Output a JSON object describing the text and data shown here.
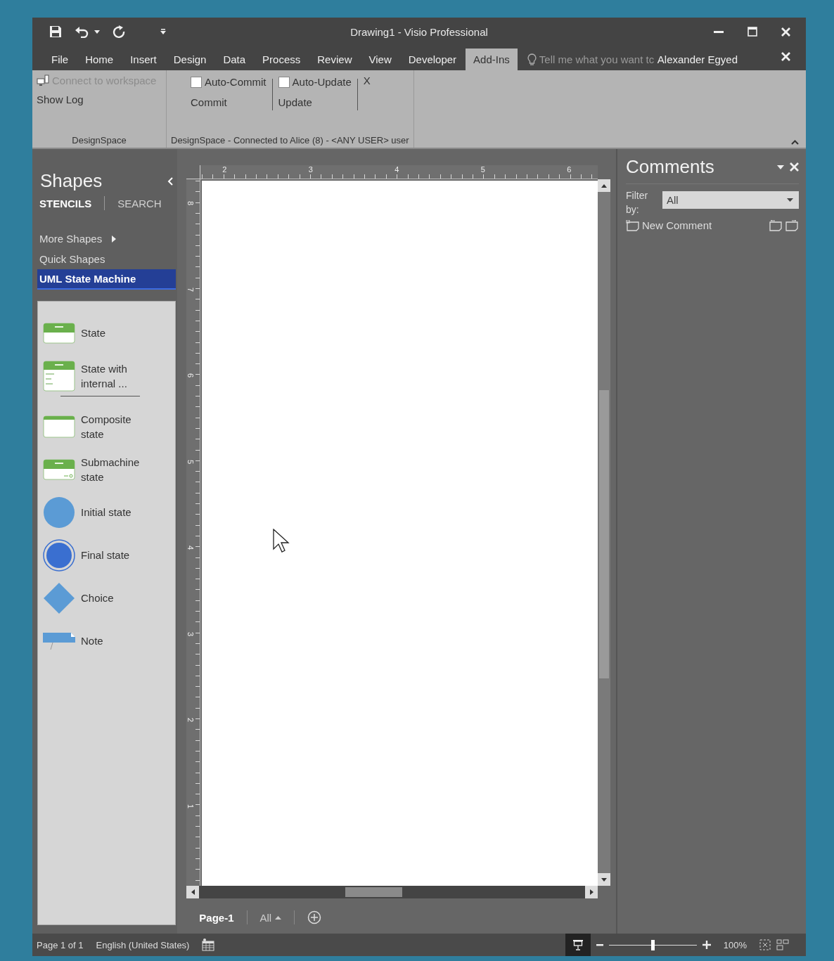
{
  "window": {
    "title": "Drawing1 - Visio Professional"
  },
  "ribbon_tabs": [
    {
      "label": "File",
      "selected": false
    },
    {
      "label": "Home",
      "selected": false
    },
    {
      "label": "Insert",
      "selected": false
    },
    {
      "label": "Design",
      "selected": false
    },
    {
      "label": "Data",
      "selected": false
    },
    {
      "label": "Process",
      "selected": false
    },
    {
      "label": "Review",
      "selected": false
    },
    {
      "label": "View",
      "selected": false
    },
    {
      "label": "Developer",
      "selected": false
    },
    {
      "label": "Add-Ins",
      "selected": true
    }
  ],
  "tell_me": {
    "placeholder": "Tell me what you want tc"
  },
  "user": "Alexander Egyed",
  "ribbon": {
    "groups": [
      {
        "label": "DesignSpace",
        "columns": [
          [
            {
              "kind": "button",
              "label": "Connect to workspace",
              "disabled": true,
              "icon": true
            },
            {
              "kind": "button",
              "label": "Show Log",
              "disabled": false
            }
          ]
        ]
      },
      {
        "label": "DesignSpace - Connected to Alice (8) - <ANY USER> user",
        "columns": [
          [
            {
              "kind": "checkbox",
              "label": "Auto-Commit",
              "checked": false
            },
            {
              "kind": "button",
              "label": "Commit",
              "disabled": false
            }
          ],
          [
            {
              "kind": "checkbox",
              "label": "Auto-Update",
              "checked": false
            },
            {
              "kind": "button",
              "label": "Update",
              "disabled": false
            }
          ],
          [
            {
              "kind": "button",
              "label": "X",
              "disabled": false
            }
          ]
        ]
      }
    ]
  },
  "shapes": {
    "title": "Shapes",
    "tabs": [
      {
        "label": "STENCILS",
        "selected": true
      },
      {
        "label": "SEARCH",
        "selected": false
      }
    ],
    "nav": [
      {
        "label": "More Shapes",
        "submenu": true,
        "selected": false
      },
      {
        "label": "Quick Shapes",
        "submenu": false,
        "selected": false
      },
      {
        "label": "UML State Machine",
        "submenu": false,
        "selected": true
      }
    ],
    "stencil": [
      {
        "kind": "state",
        "label": "State"
      },
      {
        "kind": "state-internal",
        "label": "State with internal ..."
      },
      {
        "kind": "separator"
      },
      {
        "kind": "composite",
        "label": "Composite state"
      },
      {
        "kind": "submachine",
        "label": "Submachine state"
      },
      {
        "kind": "initial",
        "label": "Initial state"
      },
      {
        "kind": "final",
        "label": "Final state"
      },
      {
        "kind": "choice",
        "label": "Choice"
      },
      {
        "kind": "note",
        "label": "Note"
      }
    ]
  },
  "canvas": {
    "h_ruler": [
      "2",
      "3",
      "4",
      "5",
      "6"
    ],
    "v_ruler": [
      "8",
      "7",
      "6",
      "5",
      "4",
      "3",
      "2",
      "1"
    ],
    "page_tabs": [
      {
        "kind": "page",
        "label": "Page-1",
        "selected": true
      },
      {
        "kind": "all",
        "label": "All",
        "selected": false
      }
    ]
  },
  "comments": {
    "title": "Comments",
    "filter_label": "Filter by:",
    "filter": {
      "value": "All"
    },
    "new_comment": "New Comment"
  },
  "status_bar": {
    "page": "Page 1 of 1",
    "language": "English (United States)",
    "zoom": {
      "level": 0.5
    },
    "zoom_text": "100%"
  }
}
